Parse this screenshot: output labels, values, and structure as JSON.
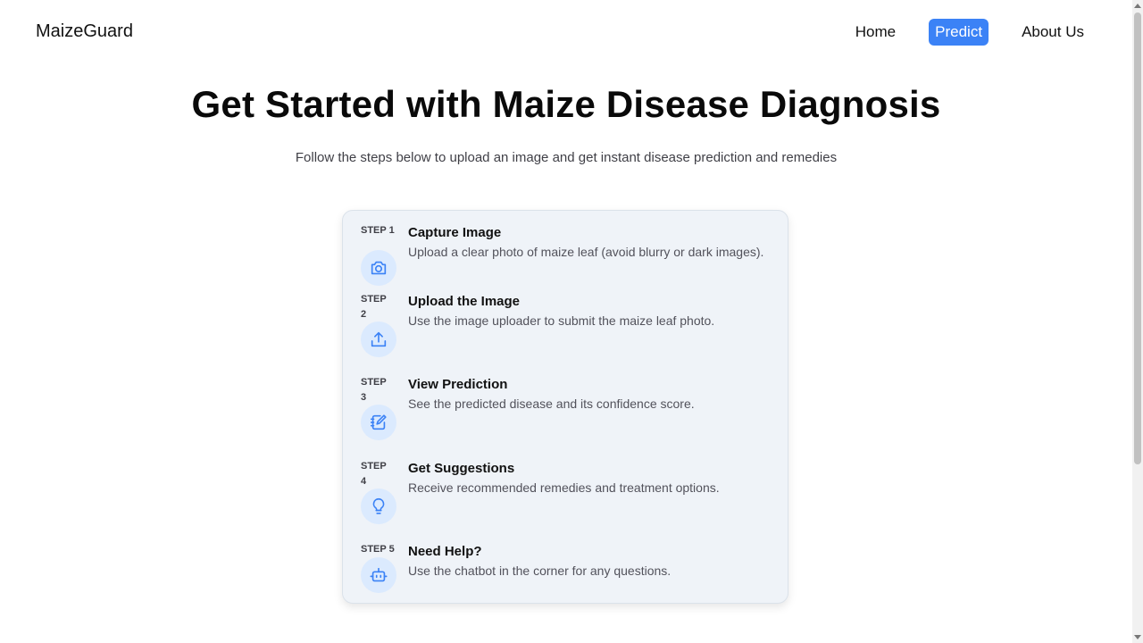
{
  "nav": {
    "brand": "MaizeGuard",
    "links": [
      {
        "label": "Home",
        "active": false
      },
      {
        "label": "Predict",
        "active": true
      },
      {
        "label": "About Us",
        "active": false
      }
    ]
  },
  "hero": {
    "title": "Get Started with Maize Disease Diagnosis",
    "subtitle": "Follow the steps below to upload an image and get instant disease prediction and remedies"
  },
  "steps": [
    {
      "tag": "STEP 1",
      "title": "Capture Image",
      "desc": "Upload a clear photo of maize leaf (avoid blurry or dark images).",
      "icon": "camera-icon"
    },
    {
      "tag": "STEP 2",
      "title": "Upload the Image",
      "desc": "Use the image uploader to submit the maize leaf photo.",
      "icon": "upload-icon"
    },
    {
      "tag": "STEP 3",
      "title": "View Prediction",
      "desc": "See the predicted disease and its confidence score.",
      "icon": "notebook-edit-icon"
    },
    {
      "tag": "STEP 4",
      "title": "Get Suggestions",
      "desc": "Receive recommended remedies and treatment options.",
      "icon": "lightbulb-icon"
    },
    {
      "tag": "STEP 5",
      "title": "Need Help?",
      "desc": "Use the chatbot in the corner for any questions.",
      "icon": "bot-icon"
    }
  ],
  "colors": {
    "accent": "#3b82f6",
    "card_bg": "#eff3f8",
    "icon_bg": "#dbeafe"
  }
}
